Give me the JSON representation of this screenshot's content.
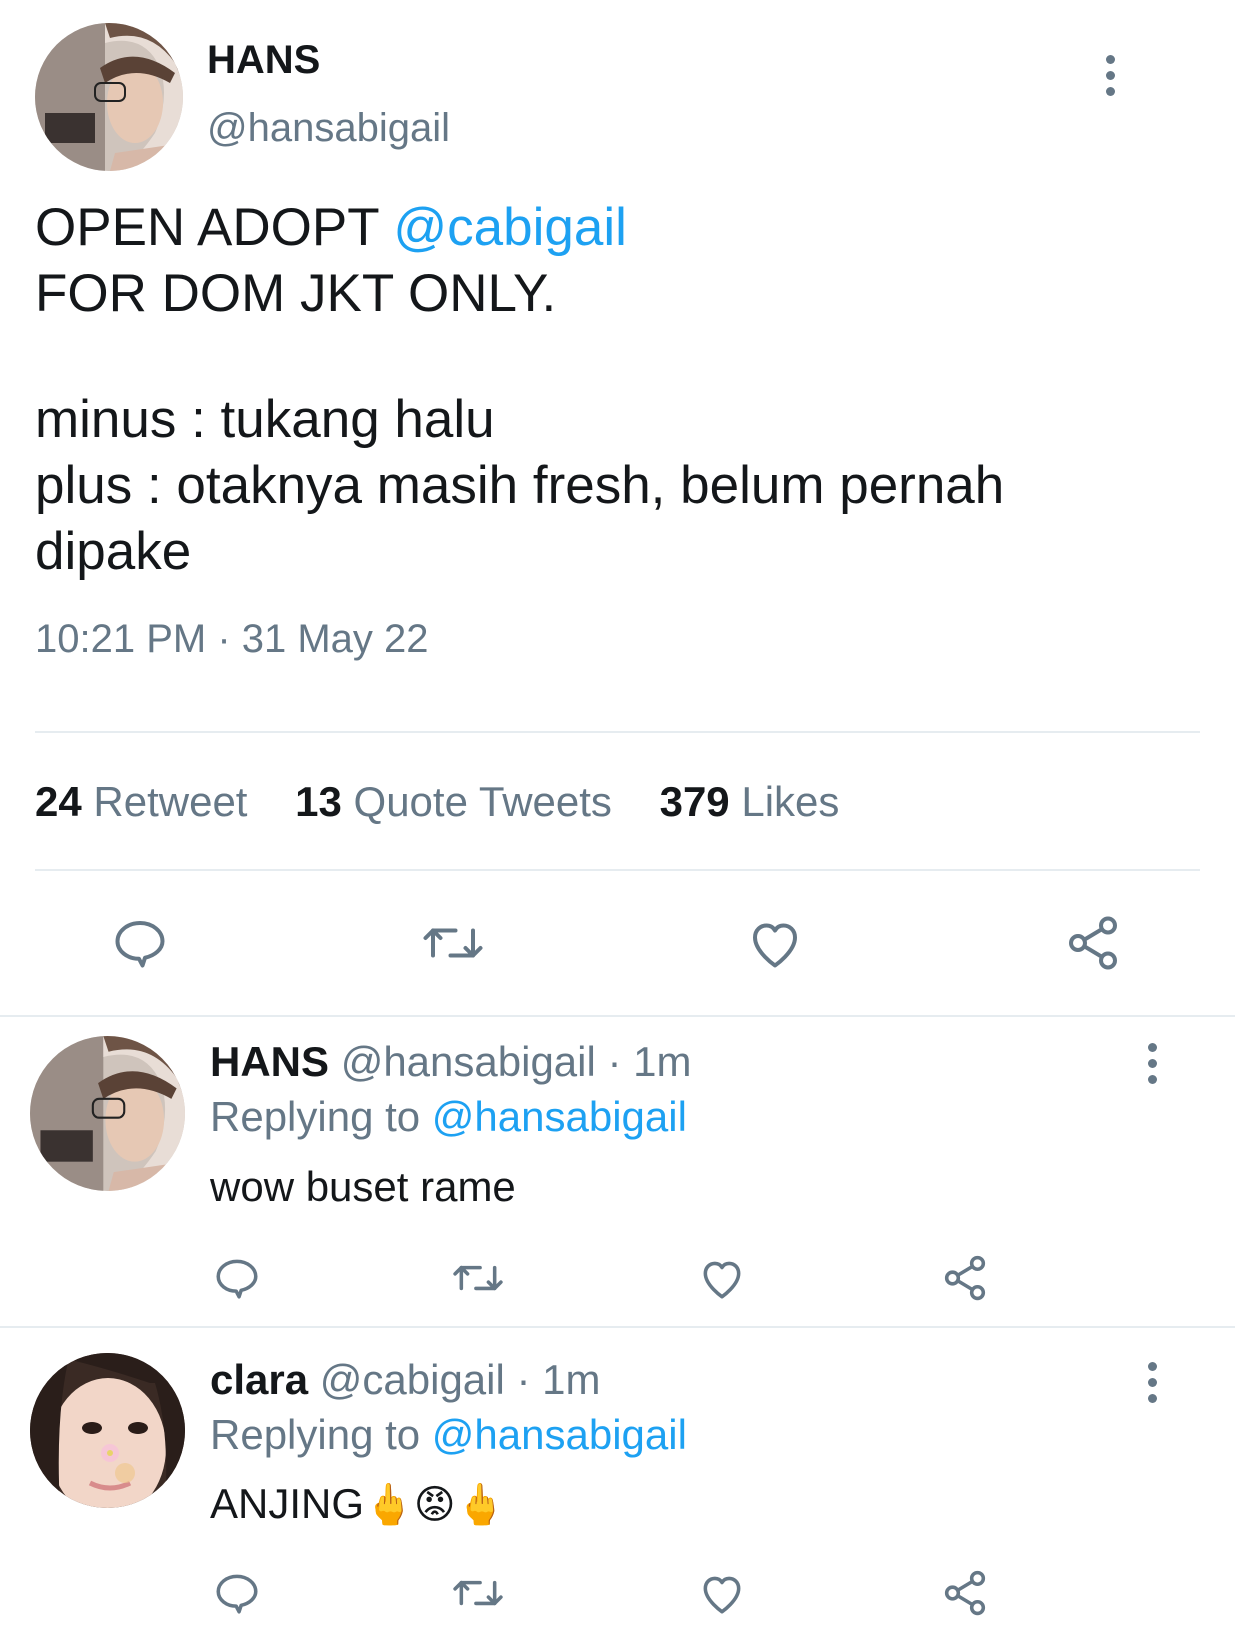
{
  "main_tweet": {
    "display_name": "HANS",
    "handle": "@hansabigail",
    "text": {
      "line1_prefix": "OPEN ADOPT ",
      "line1_mention": "@cabigail",
      "line2": "FOR DOM JKT ONLY.",
      "line3": "minus : tukang halu",
      "line4": "plus : otaknya masih fresh, belum pernah",
      "line5": "dipake"
    },
    "timestamp": "10:21 PM · 31 May 22",
    "stats": {
      "retweets_count": "24",
      "retweets_label": "Retweet",
      "quotes_count": "13",
      "quotes_label": "Quote Tweets",
      "likes_count": "379",
      "likes_label": "Likes"
    }
  },
  "replies": [
    {
      "display_name": "HANS",
      "handle": "@hansabigail",
      "time": "· 1m",
      "replying_label": "Replying to",
      "replying_to": "@hansabigail",
      "text": "wow buset rame"
    },
    {
      "display_name": "clara",
      "handle": "@cabigail",
      "time": "· 1m",
      "replying_label": "Replying to",
      "replying_to": "@hansabigail",
      "text": "ANJING",
      "emojis": "🖕😡🖕"
    }
  ],
  "icons": [
    "more-vertical-icon",
    "reply-icon",
    "retweet-icon",
    "like-icon",
    "share-icon"
  ],
  "colors": {
    "link": "#1da1f2",
    "secondary": "#657786",
    "divider": "#e6ecf0",
    "text": "#14171a"
  }
}
